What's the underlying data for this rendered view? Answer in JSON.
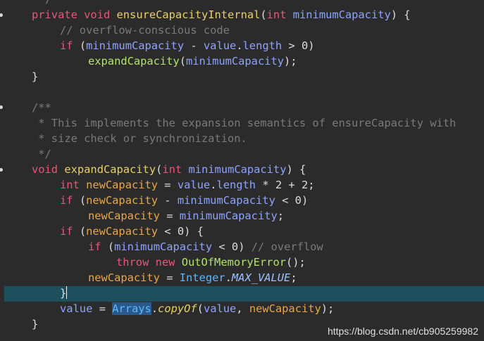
{
  "code": {
    "top_comment_tail": "/",
    "l1": {
      "kw1": "private",
      "kw2": "void",
      "name": "ensureCapacityInternal",
      "open": "(",
      "type": "int",
      "param": "minimumCapacity",
      "close": ") {"
    },
    "l2": {
      "comment": "// overflow-conscious code"
    },
    "l3": {
      "kw": "if",
      "open": " (",
      "a": "minimumCapacity",
      "op": " - ",
      "b": "value",
      "dot": ".",
      "c": "length",
      "gt": " > ",
      "num": "0",
      "close": ")"
    },
    "l4": {
      "call": "expandCapacity",
      "open": "(",
      "arg": "minimumCapacity",
      "close": ");"
    },
    "l5": {
      "brace": "}"
    },
    "l6": {
      "c1": "/**"
    },
    "l7": {
      "c2": " * This implements the expansion semantics of ensureCapacity with"
    },
    "l8": {
      "c3": " * size check or synchronization."
    },
    "l9": {
      "c4": " */"
    },
    "l10": {
      "kw": "void",
      "name": "expandCapacity",
      "open": "(",
      "type": "int",
      "param": "minimumCapacity",
      "close": ") {"
    },
    "l11": {
      "type": "int",
      "var": "newCapacity",
      "eq": " = ",
      "a": "value",
      "dot": ".",
      "b": "length",
      "rest": " * 2 + 2;"
    },
    "l12": {
      "kw": "if",
      "open": " (",
      "a": "newCapacity",
      "op": " - ",
      "b": "minimumCapacity",
      "lt": " < ",
      "num": "0",
      "close": ")"
    },
    "l13": {
      "a": "newCapacity",
      "eq": " = ",
      "b": "minimumCapacity",
      "end": ";"
    },
    "l14": {
      "kw": "if",
      "open": " (",
      "a": "newCapacity",
      "lt": " < ",
      "num": "0",
      "close": ") {"
    },
    "l15": {
      "kw": "if",
      "open": " (",
      "a": "minimumCapacity",
      "lt": " < ",
      "num": "0",
      "close": ") ",
      "comment": "// overflow"
    },
    "l16": {
      "kw1": "throw",
      "kw2": "new",
      "call": "OutOfMemoryError",
      "end": "();"
    },
    "l17": {
      "a": "newCapacity",
      "eq": " = ",
      "cls": "Integer",
      "dot": ".",
      "const": "MAX_VALUE",
      "end": ";"
    },
    "l18": {
      "brace": "}"
    },
    "l19": {
      "a": "value",
      "eq": " = ",
      "cls": "Arrays",
      "dot": ".",
      "method": "copyOf",
      "open": "(",
      "b": "value",
      "comma": ", ",
      "c": "newCapacity",
      "end": ");"
    },
    "l20": {
      "brace": "}"
    }
  },
  "watermark": "https://blog.csdn.net/cb905259982",
  "colors": {
    "background": "#2b2b2b",
    "current_line": "#1e4f5c",
    "keyword": "#e8567a",
    "comment": "#7a7a7a",
    "selection": "#2a5a8c"
  }
}
